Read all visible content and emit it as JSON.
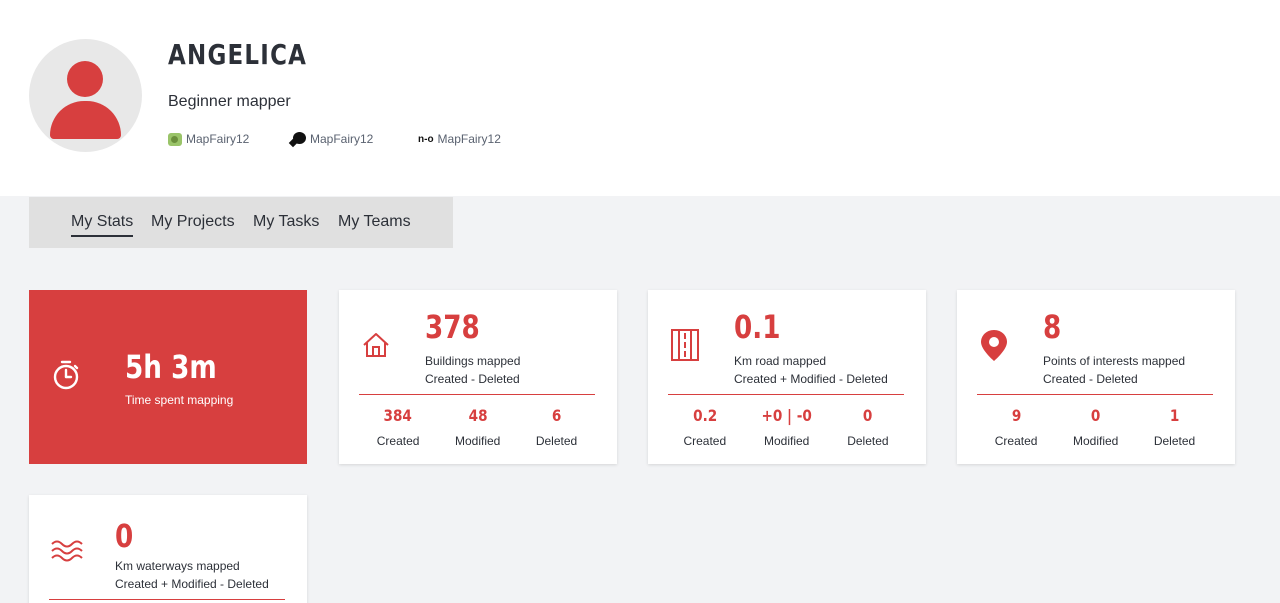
{
  "profile": {
    "username": "ANGELICA",
    "level": "Beginner mapper",
    "social": {
      "osm": "MapFairy12",
      "slack": "MapFairy12",
      "osmcha": "MapFairy12",
      "osmcha_icon_text": "n-o"
    }
  },
  "tabs": [
    "My Stats",
    "My Projects",
    "My Tasks",
    "My Teams"
  ],
  "active_tab": "My Stats",
  "colors": {
    "accent": "#d73f3f",
    "text": "#2c3038",
    "background": "#f2f3f5",
    "tabbar": "#e0e0e0"
  },
  "time_card": {
    "value": "5h 3m",
    "label": "Time spent mapping",
    "icon": "stopwatch-icon"
  },
  "buildings": {
    "icon": "house-icon",
    "value": "378",
    "title": "Buildings mapped",
    "formula": "Created - Deleted",
    "metrics": [
      {
        "value": "384",
        "label": "Created"
      },
      {
        "value": "48",
        "label": "Modified"
      },
      {
        "value": "6",
        "label": "Deleted"
      }
    ]
  },
  "roads": {
    "icon": "road-icon",
    "value": "0.1",
    "title": "Km road mapped",
    "formula": "Created + Modified - Deleted",
    "metrics": [
      {
        "value": "0.2",
        "label": "Created"
      },
      {
        "value": "+0 | -0",
        "label": "Modified"
      },
      {
        "value": "0",
        "label": "Deleted"
      }
    ]
  },
  "pois": {
    "icon": "map-pin-icon",
    "value": "8",
    "title": "Points of interests mapped",
    "formula": "Created - Deleted",
    "metrics": [
      {
        "value": "9",
        "label": "Created"
      },
      {
        "value": "0",
        "label": "Modified"
      },
      {
        "value": "1",
        "label": "Deleted"
      }
    ]
  },
  "waterways": {
    "icon": "waves-icon",
    "value": "0",
    "title": "Km waterways mapped",
    "formula": "Created + Modified - Deleted"
  }
}
